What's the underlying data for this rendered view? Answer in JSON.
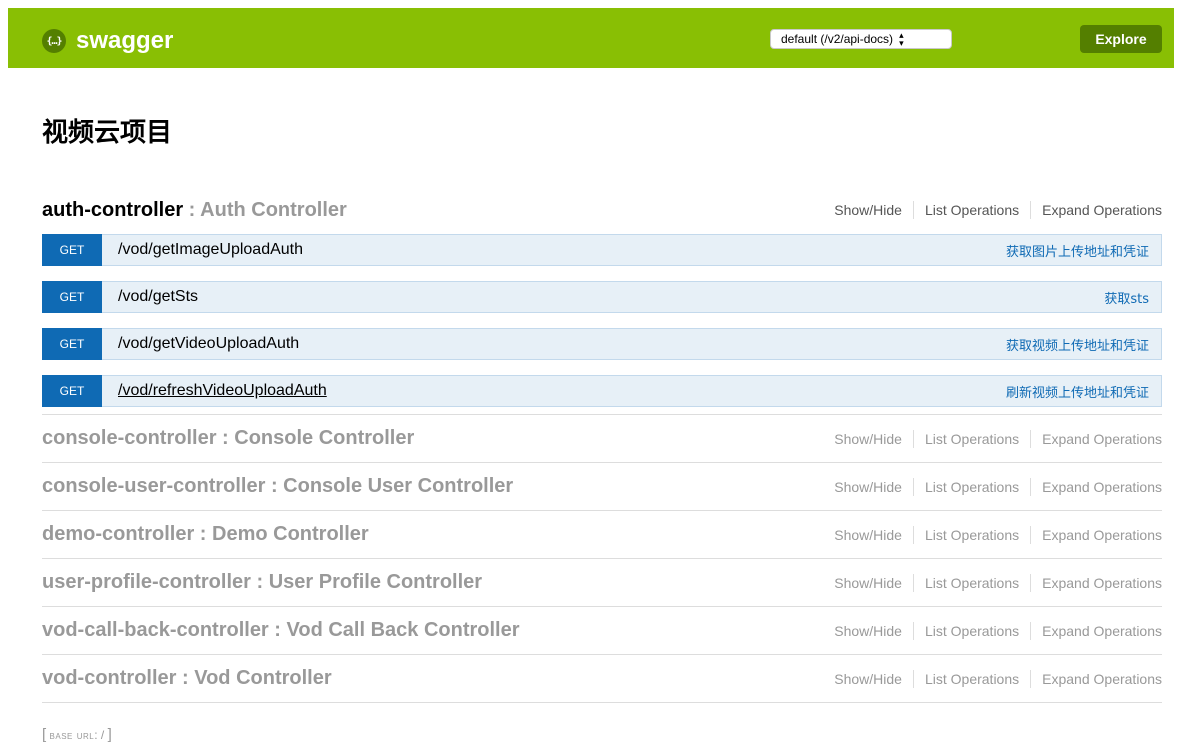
{
  "header": {
    "logo_glyph": "{…}",
    "logo_text": "swagger",
    "spec_select": "default (/v2/api-docs)",
    "explore_label": "Explore",
    "color": "#89bf04"
  },
  "page_title": "视频云项目",
  "resources": [
    {
      "name": "auth-controller",
      "desc": " : Auth Controller",
      "show_hide": "Show/Hide",
      "list_ops": "List Operations",
      "expand_ops": "Expand Operations",
      "endpoints": [
        {
          "method": "GET",
          "path": "/vod/getImageUploadAuth",
          "summary": "获取图片上传地址和凭证"
        },
        {
          "method": "GET",
          "path": "/vod/getSts",
          "summary": "获取sts"
        },
        {
          "method": "GET",
          "path": "/vod/getVideoUploadAuth",
          "summary": "获取视频上传地址和凭证"
        },
        {
          "method": "GET",
          "path": "/vod/refreshVideoUploadAuth",
          "summary": "刷新视频上传地址和凭证"
        }
      ]
    },
    {
      "name": "console-controller",
      "desc": " : Console Controller",
      "show_hide": "Show/Hide",
      "list_ops": "List Operations",
      "expand_ops": "Expand Operations"
    },
    {
      "name": "console-user-controller",
      "desc": " : Console User Controller",
      "show_hide": "Show/Hide",
      "list_ops": "List Operations",
      "expand_ops": "Expand Operations"
    },
    {
      "name": "demo-controller",
      "desc": " : Demo Controller",
      "show_hide": "Show/Hide",
      "list_ops": "List Operations",
      "expand_ops": "Expand Operations"
    },
    {
      "name": "user-profile-controller",
      "desc": " : User Profile Controller",
      "show_hide": "Show/Hide",
      "list_ops": "List Operations",
      "expand_ops": "Expand Operations"
    },
    {
      "name": "vod-call-back-controller",
      "desc": " : Vod Call Back Controller",
      "show_hide": "Show/Hide",
      "list_ops": "List Operations",
      "expand_ops": "Expand Operations"
    },
    {
      "name": "vod-controller",
      "desc": " : Vod Controller",
      "show_hide": "Show/Hide",
      "list_ops": "List Operations",
      "expand_ops": "Expand Operations"
    }
  ],
  "footer": {
    "open_bracket": "[",
    "base_url_label": "base url",
    "base_url_value": ": /",
    "close_bracket": "]"
  }
}
